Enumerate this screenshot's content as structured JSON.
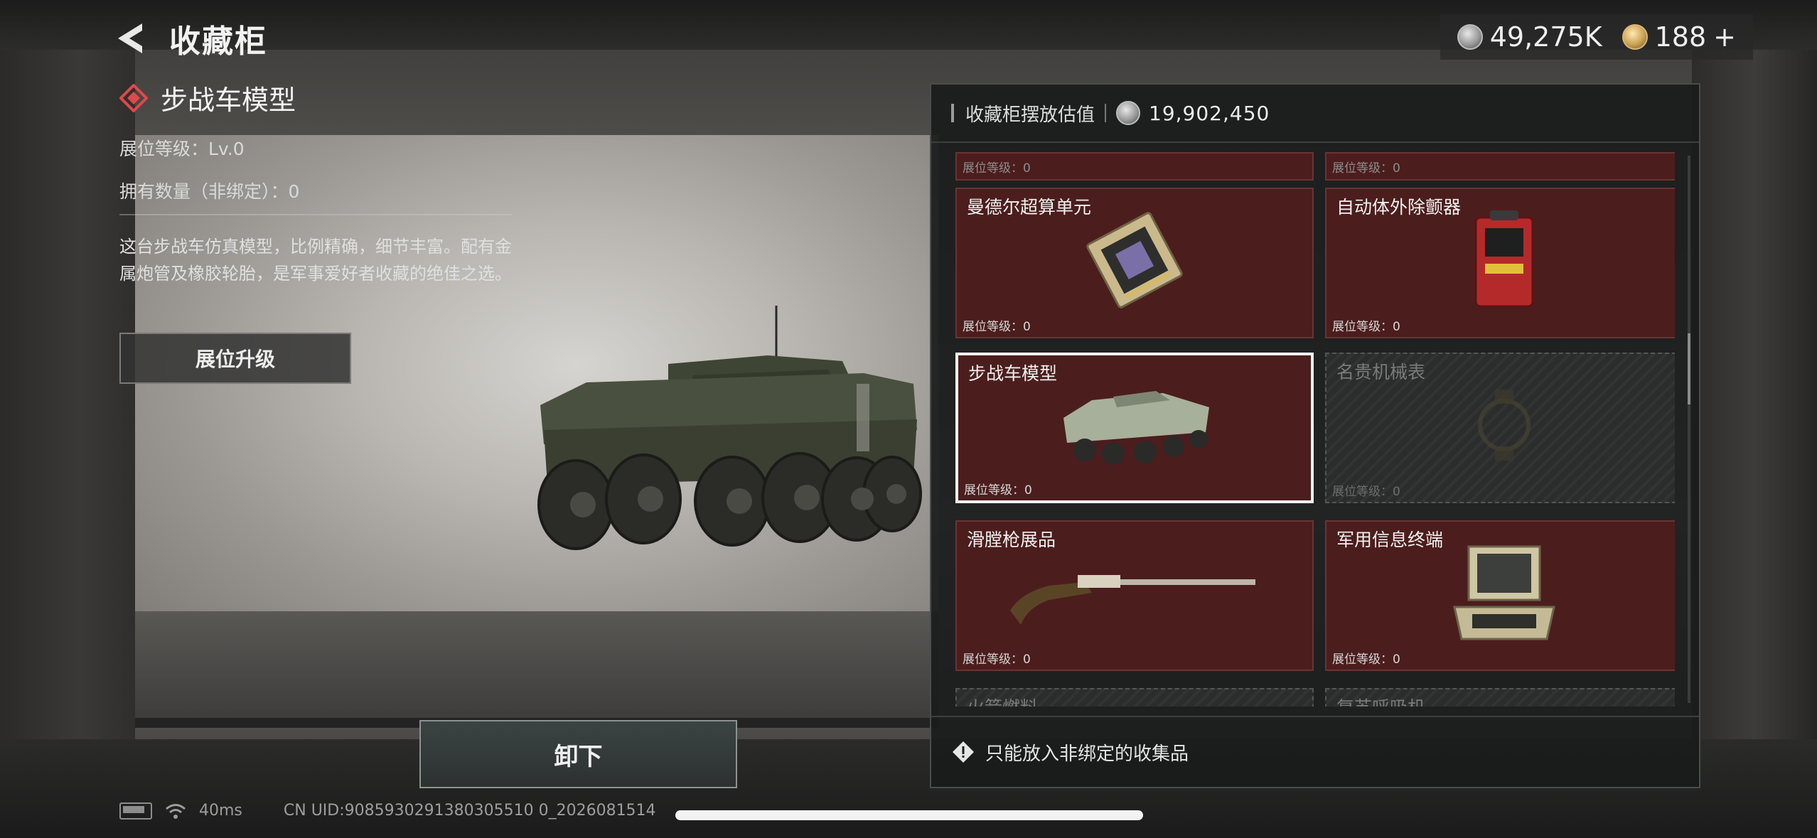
{
  "header": {
    "title": "收藏柜"
  },
  "currency": {
    "silver": "49,275K",
    "gold": "188",
    "gold_add": "+"
  },
  "item": {
    "title": "步战车模型",
    "level_line": "展位等级：Lv.0",
    "owned_line": "拥有数量（非绑定）：0",
    "description": "这台步战车仿真模型，比例精确，细节丰富。配有金属炮管及橡胶轮胎，是军事爱好者收藏的绝佳之选。",
    "upgrade_label": "展位升级",
    "unload_label": "卸下"
  },
  "status": {
    "ping": "40ms",
    "uid": "CN UID:9085930291380305510 0_2026081514"
  },
  "panel": {
    "title": "收藏柜摆放估值",
    "value": "19,902,450",
    "footer_note": "只能放入非绑定的收集品",
    "cards": [
      {
        "name": "",
        "level": "展位等级：0",
        "state": "stub"
      },
      {
        "name": "",
        "level": "展位等级：0",
        "state": "stub"
      },
      {
        "name": "曼德尔超算单元",
        "level": "展位等级：0",
        "state": "normal",
        "icon": "supercomputer-unit-icon"
      },
      {
        "name": "自动体外除颤器",
        "level": "展位等级：0",
        "state": "normal",
        "icon": "defibrillator-icon"
      },
      {
        "name": "步战车模型",
        "level": "展位等级：0",
        "state": "selected",
        "icon": "ifv-model-icon"
      },
      {
        "name": "名贵机械表",
        "level": "展位等级：0",
        "state": "locked",
        "icon": "mechanical-watch-icon"
      },
      {
        "name": "滑膛枪展品",
        "level": "展位等级：0",
        "state": "normal",
        "icon": "musket-icon"
      },
      {
        "name": "军用信息终端",
        "level": "展位等级：0",
        "state": "normal",
        "icon": "military-terminal-icon"
      },
      {
        "name": "火箭燃料",
        "level": "",
        "state": "stub"
      },
      {
        "name": "复苏呼吸机",
        "level": "",
        "state": "stub"
      }
    ]
  },
  "colors": {
    "card_red": "#4c1d1d",
    "panel_bg": "#1a1c1c",
    "accent_red": "#e0484a"
  }
}
